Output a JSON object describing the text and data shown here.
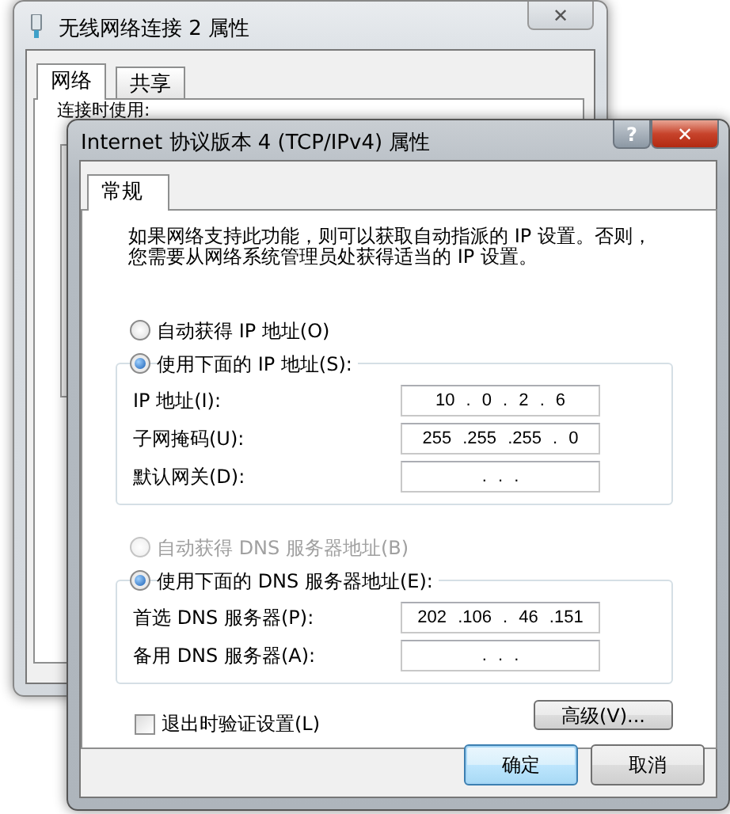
{
  "background_window": {
    "title": "无线网络连接 2 属性",
    "close_glyph": "✕",
    "tabs": [
      {
        "label": "网络",
        "selected": true
      },
      {
        "label": "共享",
        "selected": false
      }
    ],
    "section_label": "连接时使用:"
  },
  "dialog": {
    "title": "Internet 协议版本 4 (TCP/IPv4) 属性",
    "help_glyph": "?",
    "close_glyph": "✕",
    "tabs": [
      {
        "label": "常规",
        "selected": true
      }
    ],
    "description": "如果网络支持此功能，则可以获取自动指派的 IP 设置。否则，您需要从网络系统管理员处获得适当的 IP 设置。",
    "ip_options": [
      {
        "label": "自动获得 IP 地址(O)",
        "selected": false,
        "disabled": false
      },
      {
        "label": "使用下面的 IP 地址(S):",
        "selected": true,
        "disabled": false
      }
    ],
    "ip_fields": [
      {
        "label": "IP 地址(I):",
        "value": "10 . 0 . 2 . 6"
      },
      {
        "label": "子网掩码(U):",
        "value": "255 .255 .255 . 0"
      },
      {
        "label": "默认网关(D):",
        "value": ". . ."
      }
    ],
    "dns_options": [
      {
        "label": "自动获得 DNS 服务器地址(B)",
        "selected": false,
        "disabled": true
      },
      {
        "label": "使用下面的 DNS 服务器地址(E):",
        "selected": true,
        "disabled": false
      }
    ],
    "dns_fields": [
      {
        "label": "首选 DNS 服务器(P):",
        "value": "202 .106 . 46 .151"
      },
      {
        "label": "备用 DNS 服务器(A):",
        "value": ". . ."
      }
    ],
    "validate_checkbox": {
      "label": "退出时验证设置(L)",
      "checked": false
    },
    "advanced_button": "高级(V)...",
    "buttons": [
      {
        "label": "确定",
        "default": true
      },
      {
        "label": "取消",
        "default": false
      }
    ]
  }
}
